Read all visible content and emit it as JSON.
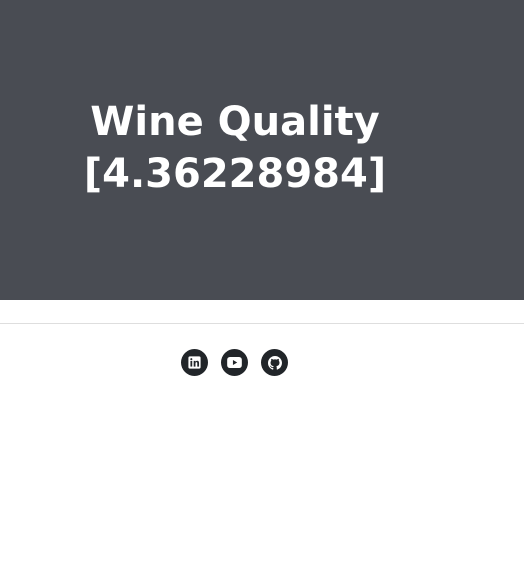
{
  "hero": {
    "title_line1": "Wine Quality",
    "title_line2": "[4.36228984]",
    "background": "#494c53"
  },
  "footer": {
    "social_links": [
      {
        "icon": "linkedin-icon",
        "label": "LinkedIn"
      },
      {
        "icon": "youtube-icon",
        "label": "YouTube"
      },
      {
        "icon": "github-icon",
        "label": "GitHub"
      }
    ],
    "icon_background": "#212529"
  }
}
